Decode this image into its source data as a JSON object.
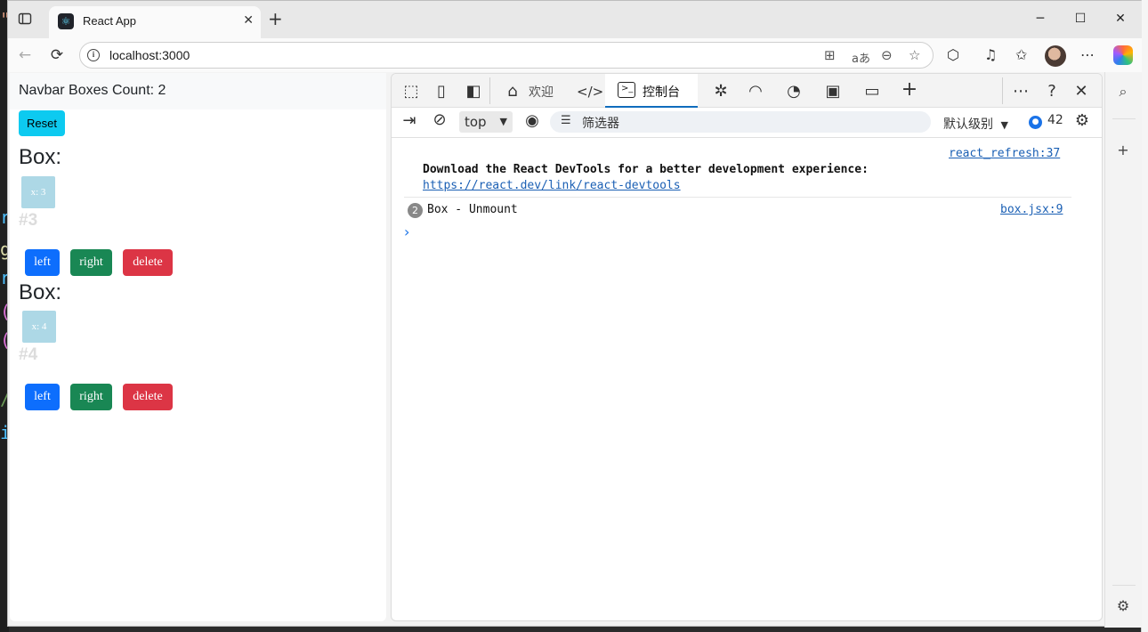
{
  "browser": {
    "tab_title": "React App",
    "tab_close": "✕",
    "new_tab": "+",
    "url": "localhost:3000",
    "window_controls": [
      "─",
      "☐",
      "✕"
    ]
  },
  "page": {
    "navbar_text": "Navbar Boxes Count: 2",
    "reset_label": "Reset",
    "boxes": [
      {
        "heading": "Box:",
        "square_label": "x: 3",
        "id_label": "#3",
        "left": "left",
        "right": "right",
        "delete": "delete"
      },
      {
        "heading": "Box:",
        "square_label": "x: 4",
        "id_label": "#4",
        "left": "left",
        "right": "right",
        "delete": "delete"
      }
    ]
  },
  "devtools": {
    "tabs": {
      "welcome": "欢迎",
      "console": "控制台"
    },
    "toolbar": {
      "context": "top",
      "filter_placeholder": "筛选器",
      "levels": "默认级别",
      "issues_count": "42"
    },
    "messages": [
      {
        "source": "react_refresh:37",
        "text": "Download the React DevTools for a better development experience:",
        "link": "https://react.dev/link/react-devtools"
      },
      {
        "repeat": "2",
        "text": "Box - Unmount",
        "source": "box.jsx:9"
      }
    ],
    "prompt": "›"
  },
  "colors": {
    "primary": "#0d6efd",
    "success": "#198754",
    "danger": "#dc3545",
    "info": "#0dcaf0",
    "box_fill": "#add8e6",
    "active_tab_underline": "#0f6cbd"
  }
}
